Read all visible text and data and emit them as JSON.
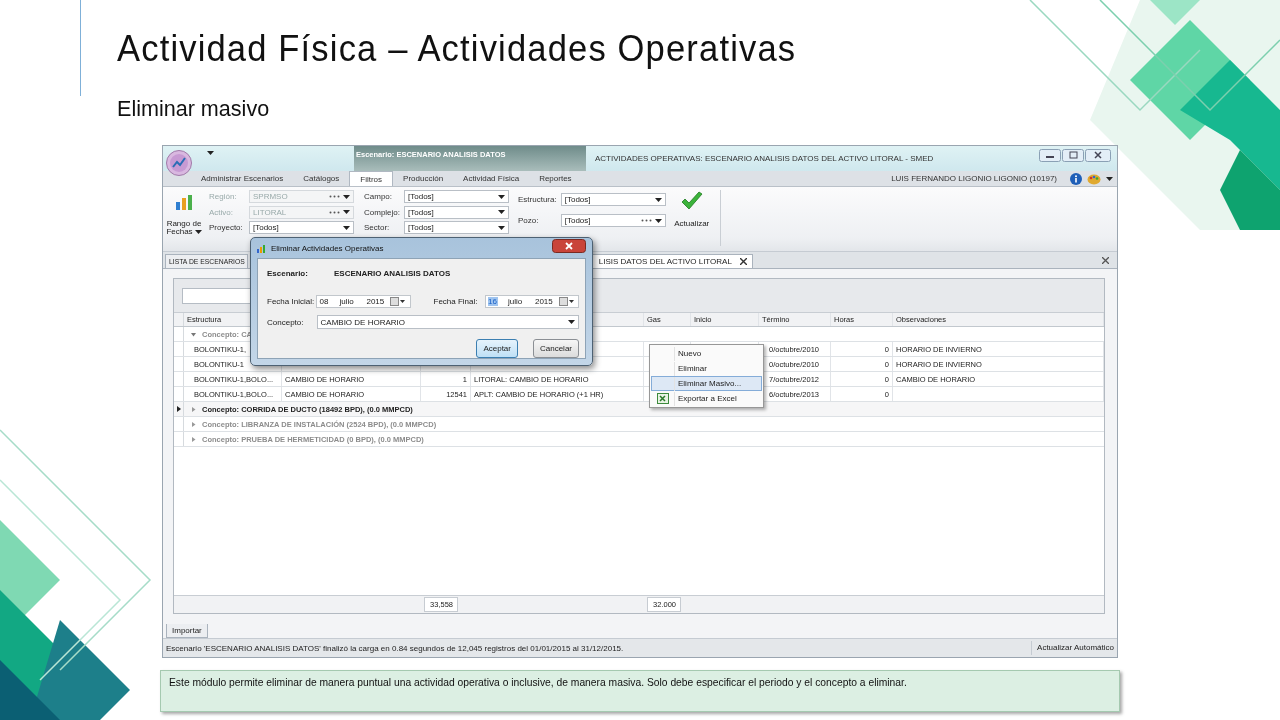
{
  "slide": {
    "title": "Actividad Física – Actividades Operativas",
    "subtitle": "Eliminar masivo",
    "note": "Este módulo permite eliminar de manera puntual una actividad operativa o inclusive, de manera masiva. Solo debe especificar el periodo y el concepto a eliminar."
  },
  "app": {
    "context_tab": "Escenario: ESCENARIO ANALISIS DATOS",
    "title": "ACTIVIDADES OPERATIVAS: ESCENARIO ANALISIS DATOS  DEL ACTIVO LITORAL - SMED",
    "user": "LUIS FERNANDO LIGONIO LIGONIO (10197)",
    "ribbon_tabs": [
      {
        "label": "Administrar Escenarios",
        "selected": false
      },
      {
        "label": "Catálogos",
        "selected": false
      },
      {
        "label": "Filtros",
        "selected": true
      },
      {
        "label": "Producción",
        "selected": false
      },
      {
        "label": "Actividad Física",
        "selected": false
      },
      {
        "label": "Reportes",
        "selected": false
      }
    ],
    "date_button": [
      "Rango de",
      "Fechas"
    ],
    "filters": [
      [
        {
          "label": "Región:",
          "value": "SPRMSO",
          "disabled": true,
          "browse": true
        },
        {
          "label": "Activo:",
          "value": "LITORAL",
          "disabled": true,
          "browse": true
        },
        {
          "label": "Proyecto:",
          "value": "[Todos]",
          "disabled": false,
          "browse": false
        }
      ],
      [
        {
          "label": "Campo:",
          "value": "[Todos]",
          "disabled": false,
          "browse": false
        },
        {
          "label": "Complejo:",
          "value": "[Todos]",
          "disabled": false,
          "browse": false
        },
        {
          "label": "Sector:",
          "value": "[Todos]",
          "disabled": false,
          "browse": false
        }
      ],
      [
        {
          "label": "Estructura:",
          "value": "[Todos]",
          "disabled": false,
          "browse": false
        },
        {
          "label": "Pozo:",
          "value": "[Todos]",
          "disabled": false,
          "browse": true
        }
      ]
    ],
    "refresh_button": "Actualizar",
    "document_tabs": [
      {
        "label": "LISTA DE ESCENARIOS",
        "selected": false,
        "closable": false
      },
      {
        "label": "LISIS DATOS  DEL ACTIVO LITORAL",
        "selected": true,
        "closable": true
      }
    ],
    "grid": {
      "columns": [
        {
          "label": "Estructura"
        },
        {},
        {
          "total": "33,558"
        },
        {},
        {
          "label": "Gas",
          "total": "32.000"
        },
        {
          "label": "Inicio"
        },
        {
          "label": "Término"
        },
        {
          "label": "Horas"
        },
        {
          "label": "Observaciones"
        }
      ],
      "rows": [
        {
          "kind": "group",
          "label": "Concepto: CA",
          "expanded": true,
          "selected": false
        },
        {
          "kind": "record",
          "cells": [
            "BOLONTIKU-1,",
            null,
            null,
            null,
            null,
            null,
            "0/octubre/2010",
            "0",
            "HORARIO DE INVIERNO"
          ]
        },
        {
          "kind": "record",
          "cells": [
            "BOLONTIKU-1",
            null,
            null,
            null,
            null,
            null,
            "0/octubre/2010",
            "0",
            "HORARIO DE INVIERNO"
          ]
        },
        {
          "kind": "record",
          "cells": [
            "BOLONTIKU-1,BOLO...",
            "CAMBIO DE HORARIO",
            "1",
            "LITORAL: CAMBIO DE HORARIO",
            null,
            null,
            "7/octubre/2012",
            "0",
            "CAMBIO DE HORARIO"
          ]
        },
        {
          "kind": "record",
          "cells": [
            "BOLONTIKU-1,BOLO...",
            "CAMBIO DE HORARIO",
            "12541",
            "APLT: CAMBIO DE HORARIO (+1 HR)",
            null,
            null,
            "6/octubre/2013",
            "0",
            null
          ]
        },
        {
          "kind": "group",
          "label": "Concepto: CORRIDA  DE DUCTO (18492 BPD), (0.0 MMPCD)",
          "expanded": false,
          "selected": true
        },
        {
          "kind": "group",
          "label": "Concepto: LIBRANZA DE INSTALACIÓN (2524 BPD), (0.0 MMPCD)",
          "expanded": false,
          "selected": false
        },
        {
          "kind": "group",
          "label": "Concepto: PRUEBA DE HERMETICIDAD (0 BPD), (0.0 MMPCD)",
          "expanded": false,
          "selected": false
        }
      ],
      "totals_row": true
    },
    "bottom_tabs": [
      "Importar"
    ],
    "status_bar": {
      "message": "Escenario 'ESCENARIO ANALISIS DATOS' finalizó la carga en 0.84 segundos de 12,045 registros del 01/01/2015 al 31/12/2015.",
      "right": "Actualizar Automático"
    },
    "dialog": {
      "title": "Eliminar Actividades Operativas",
      "scenario_label": "Escenario:",
      "scenario": "ESCENARIO ANALISIS DATOS",
      "dates": [
        {
          "label": "Fecha Inicial:",
          "day": "08",
          "month": "julio",
          "year": "2015",
          "day_selected": false
        },
        {
          "label": "Fecha Final:",
          "day": "16",
          "month": "julio",
          "year": "2015",
          "day_selected": true
        }
      ],
      "concept_label": "Concepto:",
      "concept": "CAMBIO DE HORARIO",
      "buttons": [
        {
          "label": "Aceptar",
          "default": true
        },
        {
          "label": "Cancelar",
          "default": false
        }
      ]
    },
    "context_menu": [
      {
        "label": "Nuevo",
        "selected": false,
        "kind": "command"
      },
      {
        "label": "Eliminar",
        "selected": false,
        "kind": "command"
      },
      {
        "label": "Eliminar Masivo...",
        "selected": true,
        "kind": "command"
      },
      {
        "label": "Exportar a Excel",
        "selected": false,
        "kind": "export"
      }
    ]
  }
}
